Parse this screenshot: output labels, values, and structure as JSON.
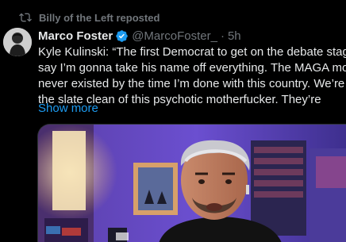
{
  "repost": {
    "icon": "repost-icon",
    "label": "Billy of the Left reposted"
  },
  "author": {
    "display_name": "Marco Foster",
    "verified_icon": "verified-badge-icon",
    "verified_color": "#1d9bf0",
    "handle": "@MarcoFoster_",
    "separator": "·",
    "time": "5h"
  },
  "tweet": {
    "text_lines": [
      "Kyle Kulinski: “The first Democrat to get on the debate stage in",
      "say I’m gonna take his name off everything. The MAGA moveme",
      "never existed by the time I’m done with this country. We’re goin",
      "the slate clean of this psychotic motherfucker. They’re"
    ],
    "show_more": "Show more"
  },
  "media": {
    "type": "video-thumbnail",
    "description_icon": "video-frame"
  },
  "colors": {
    "background": "#000000",
    "text_primary": "#e7e9ea",
    "text_secondary": "#71767b",
    "link": "#1d9bf0"
  }
}
